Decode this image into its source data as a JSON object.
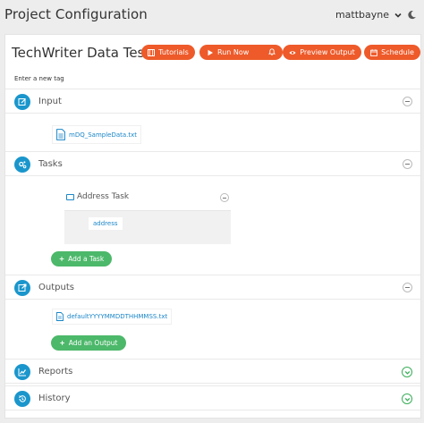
{
  "app": {
    "title": "Project Configuration",
    "user": "mattbayne"
  },
  "project": {
    "title": "TechWriter Data Test"
  },
  "toolbar": {
    "tutorials": "Tutorials",
    "run_now": "Run Now",
    "preview_output": "Preview Output",
    "schedule": "Schedule"
  },
  "tags": {
    "placeholder": "Enter a new tag"
  },
  "sections": {
    "input": {
      "title": "Input",
      "file": "mDQ_SampleData.txt"
    },
    "tasks": {
      "title": "Tasks",
      "task_name": "Address Task",
      "task_item": "address",
      "add_label": "Add a Task"
    },
    "outputs": {
      "title": "Outputs",
      "file": "defaultYYYYMMDDTHHMMSS.txt",
      "add_label": "Add an Output"
    },
    "reports": {
      "title": "Reports"
    },
    "history": {
      "title": "History"
    }
  },
  "colors": {
    "accent": "#ee5a2a",
    "info": "#1a96cc",
    "success": "#4cb86a",
    "link": "#1a86c8"
  }
}
